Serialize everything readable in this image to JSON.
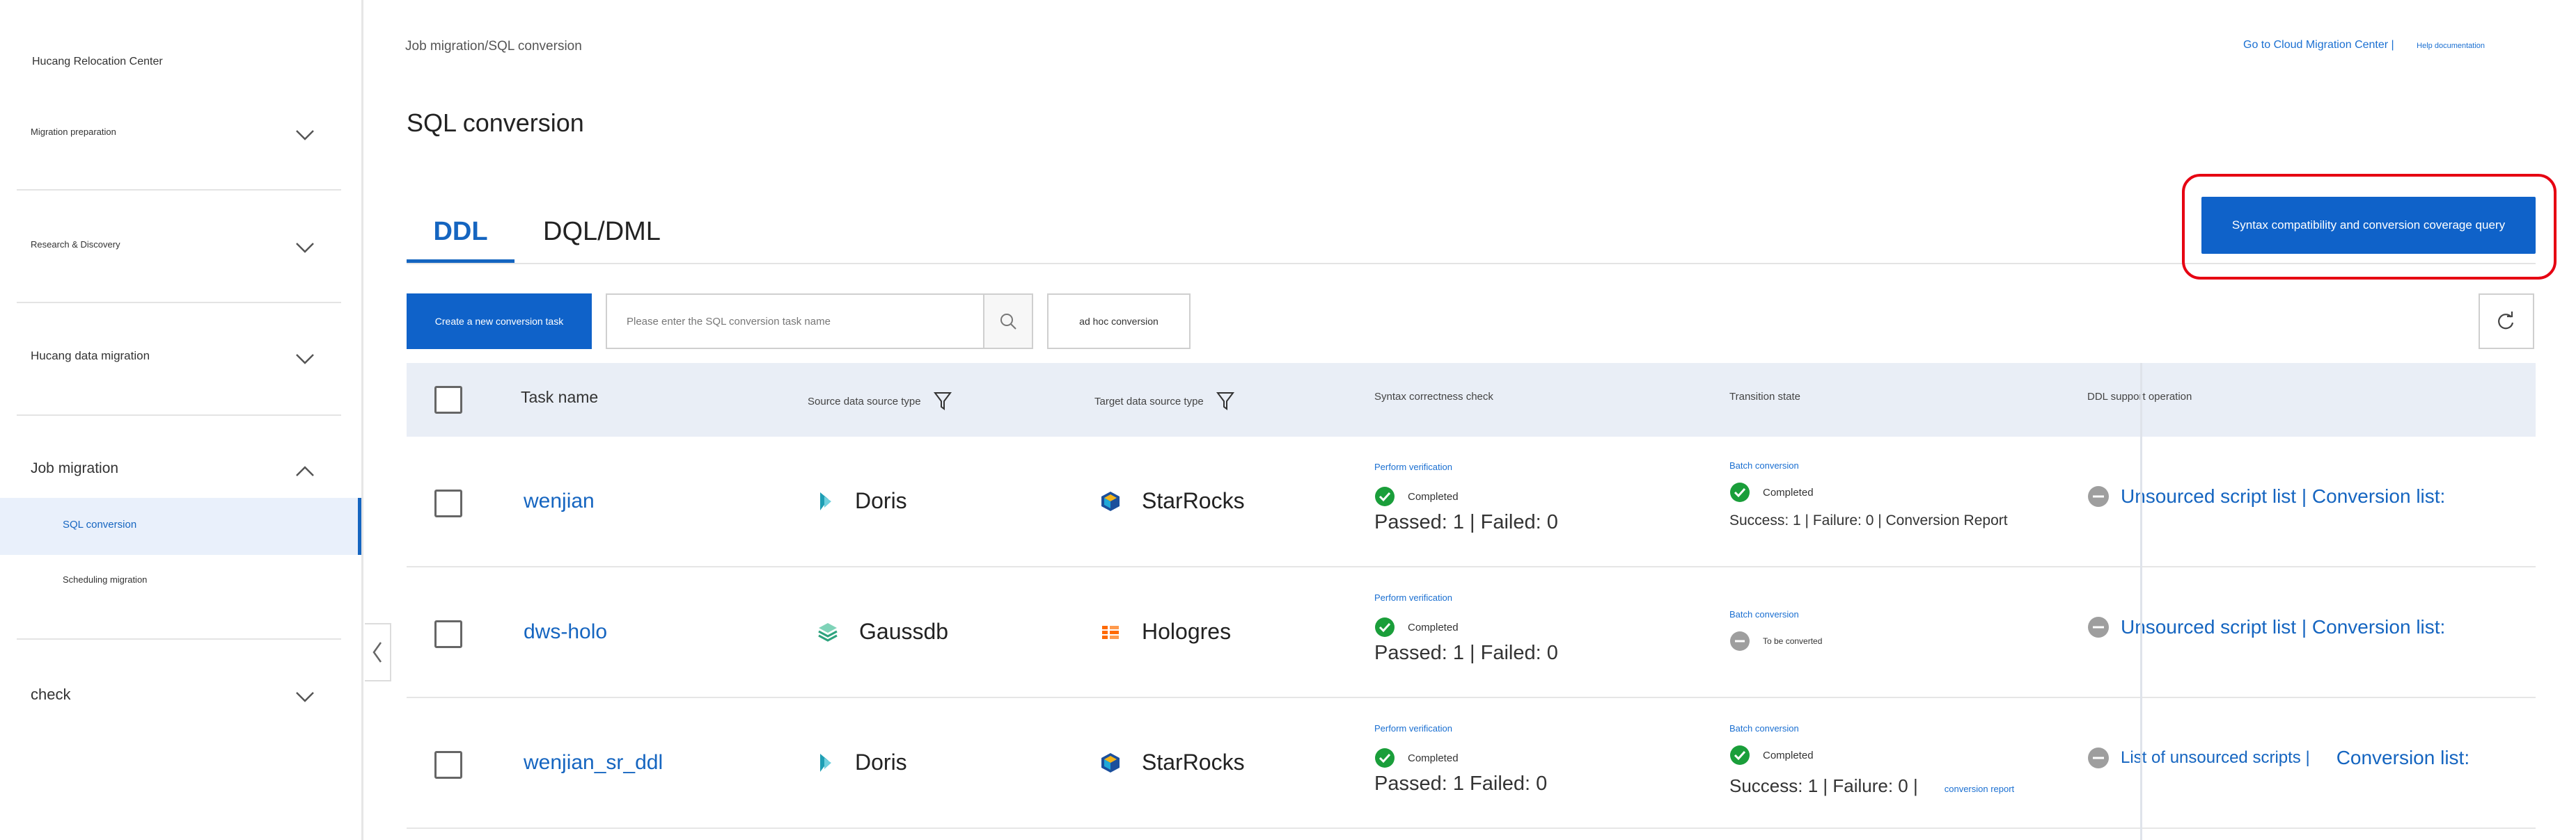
{
  "sidebar": {
    "brand": "Hucang Relocation Center",
    "groups": [
      {
        "label": "Migration preparation"
      },
      {
        "label": "Research & Discovery"
      },
      {
        "label": "Hucang data migration"
      },
      {
        "label": "Job migration"
      },
      {
        "label": "check"
      }
    ],
    "job_items": [
      {
        "label": "SQL conversion"
      },
      {
        "label": "Scheduling migration"
      }
    ]
  },
  "header": {
    "breadcrumb": "Job migration/SQL conversion",
    "cloud_link": "Go to Cloud Migration Center |",
    "help_link": "Help documentation",
    "title": "SQL conversion"
  },
  "tabs": [
    {
      "label": "DDL"
    },
    {
      "label": "DQL/DML"
    }
  ],
  "toolbar": {
    "syntax_button": "Syntax compatibility and conversion coverage query",
    "create_button": "Create a new conversion task",
    "search_placeholder": "Please enter the SQL conversion task name",
    "adhoc_button": "ad hoc conversion"
  },
  "table": {
    "columns": {
      "task_name": "Task name",
      "source_type": "Source data source type",
      "target_type": "Target data source type",
      "syntax_check": "Syntax correctness check",
      "transition_state": "Transition state",
      "ddl_operation": "DDL support operation"
    },
    "rows": [
      {
        "name": "wenjian",
        "source": "Doris",
        "source_icon": "doris-icon",
        "target": "StarRocks",
        "target_icon": "starrocks-icon",
        "verify_link": "Perform verification",
        "check_status": "Completed",
        "check_result": "Passed: 1 | Failed: 0",
        "batch_link": "Batch conversion",
        "transition_status": "Completed",
        "transition_result": "Success: 1 | Failure: 0 | Conversion Report",
        "report_link": "",
        "op_left": "Unsourced script list | Conversion list:",
        "op_right": ""
      },
      {
        "name": "dws-holo",
        "source": "Gaussdb",
        "source_icon": "gaussdb-icon",
        "target": "Hologres",
        "target_icon": "hologres-icon",
        "verify_link": "Perform verification",
        "check_status": "Completed",
        "check_result": "Passed: 1 | Failed: 0",
        "batch_link": "Batch conversion",
        "transition_status": "To be converted",
        "transition_result": "",
        "report_link": "",
        "op_left": "Unsourced script list | Conversion list:",
        "op_right": ""
      },
      {
        "name": "wenjian_sr_ddl",
        "source": "Doris",
        "source_icon": "doris-icon",
        "target": "StarRocks",
        "target_icon": "starrocks-icon",
        "verify_link": "Perform verification",
        "check_status": "Completed",
        "check_result": "Passed: 1 Failed: 0",
        "batch_link": "Batch conversion",
        "transition_status": "Completed",
        "transition_result": "Success: 1 | Failure: 0 |",
        "report_link": "conversion report",
        "op_left": "List of unsourced scripts |",
        "op_right": "Conversion list:"
      }
    ]
  },
  "colors": {
    "accent": "#0f62c9",
    "link": "#1565c0",
    "success": "#1a9e3a",
    "highlight": "#e60012",
    "header_bg": "#e9eef6"
  }
}
